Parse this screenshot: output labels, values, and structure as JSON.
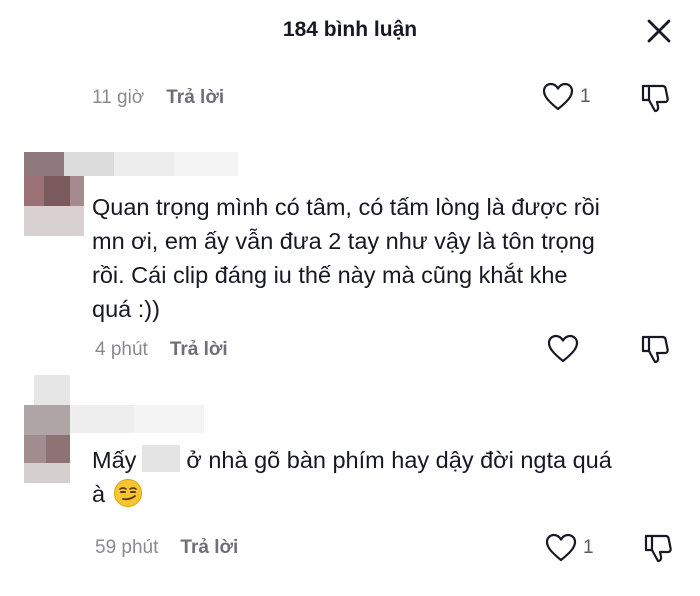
{
  "header": {
    "title": "184 bình luận"
  },
  "comments": [
    {
      "time": "11 giờ",
      "reply_label": "Trả lời",
      "like_count": "1",
      "text_lines": []
    },
    {
      "time": "4 phút",
      "reply_label": "Trả lời",
      "like_count": "",
      "text_lines": [
        "Quan trọng mình có tâm, có tấm lòng là được rồi",
        "mn ơi, em ấy vẫn đưa 2 tay như vậy là tôn trọng",
        "rồi. Cái clip đáng iu thế này mà cũng khắt khe",
        "quá :))"
      ]
    },
    {
      "time": "59 phút",
      "reply_label": "Trả lời",
      "like_count": "1",
      "text_before_censor": "Mấy",
      "text_after_censor": "ở nhà gõ bàn phím hay dậy đời ngta quá",
      "text_line2": "à"
    }
  ],
  "icons": {
    "close": "close-icon",
    "like": "heart-outline-icon",
    "dislike": "thumbs-down-icon",
    "emoji": "smirk-emoji"
  },
  "colors": {
    "text": "#161823",
    "meta": "#8a8b91",
    "icon": "#161823"
  }
}
